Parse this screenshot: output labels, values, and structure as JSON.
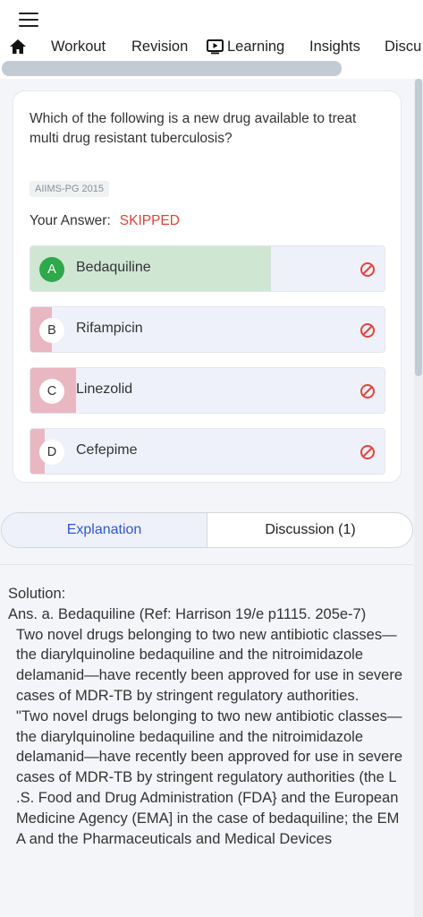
{
  "nav": {
    "tabs": [
      "Workout",
      "Revision",
      "Learning",
      "Insights",
      "Discu"
    ]
  },
  "question": {
    "text": "Which of the following is a new drug available to treat multi drug resistant tuberculosis?",
    "tag": "AIIMS-PG 2015",
    "answer_label": "Your Answer:",
    "answer_status": "SKIPPED"
  },
  "options": [
    {
      "letter": "A",
      "label": "Bedaquiline",
      "correct": true,
      "fill_fraction": 0.68
    },
    {
      "letter": "B",
      "label": "Rifampicin",
      "correct": false,
      "fill_fraction": 0.06
    },
    {
      "letter": "C",
      "label": "Linezolid",
      "correct": false,
      "fill_fraction": 0.13
    },
    {
      "letter": "D",
      "label": "Cefepime",
      "correct": false,
      "fill_fraction": 0.04
    }
  ],
  "tabs": {
    "explanation": "Explanation",
    "discussion": "Discussion (1)"
  },
  "solution": {
    "heading": "Solution:",
    "answer_line": "Ans. a. Bedaquiline (Ref: Harrison 19/e p1115. 205e-7)",
    "para1": "Two novel drugs belonging to two new antibiotic classes—the diarylquinoline bedaquiline and the nitroimidazole delamanid—have recently been approved for use in severe cases of MDR-TB by stringent regulatory authorities.",
    "para2": "\"Two novel drugs belonging to two new antibiotic classes—the diarylquinoline bedaquiline and the nitroimidazole delamanid—have recently been approved for use in severe cases of MDR-TB by stringent regulatory authorities (the L .S. Food and Drug Administration (FDA} and the European Medicine Agency (EMA] in the case of bedaquiline; the EM A and the Pharmaceuticals and Medical Devices"
  },
  "colors": {
    "correct_fill": "#cfe6d3",
    "correct_badge": "#2da84a",
    "wrong_fill": "#e8b7c2",
    "accent": "#2f57d6",
    "skipped": "#d9433b"
  }
}
